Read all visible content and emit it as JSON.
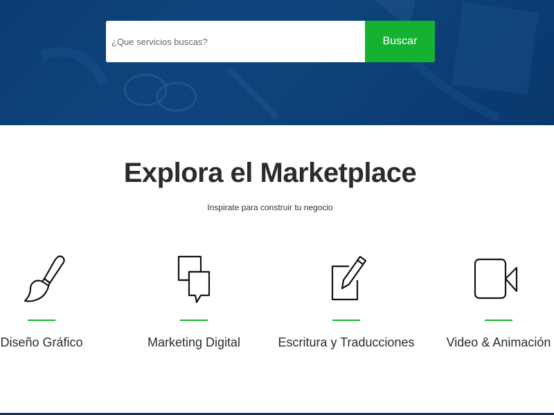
{
  "hero": {
    "search": {
      "placeholder": "¿Que servicios buscas?",
      "button_label": "Buscar"
    }
  },
  "section": {
    "title": "Explora el Marketplace",
    "subtitle": "Inspirate para construir tu negocio"
  },
  "categories": [
    {
      "label": "Diseño Gráfico",
      "icon": "paintbrush-icon"
    },
    {
      "label": "Marketing Digital",
      "icon": "chat-bubbles-icon"
    },
    {
      "label": "Escritura y Traducciones",
      "icon": "pencil-edit-icon"
    },
    {
      "label": "Video & Animación",
      "icon": "video-camera-icon"
    }
  ],
  "colors": {
    "hero_bg": "#0e4680",
    "accent_green": "#15b231",
    "text_dark": "#2b2b2b"
  }
}
